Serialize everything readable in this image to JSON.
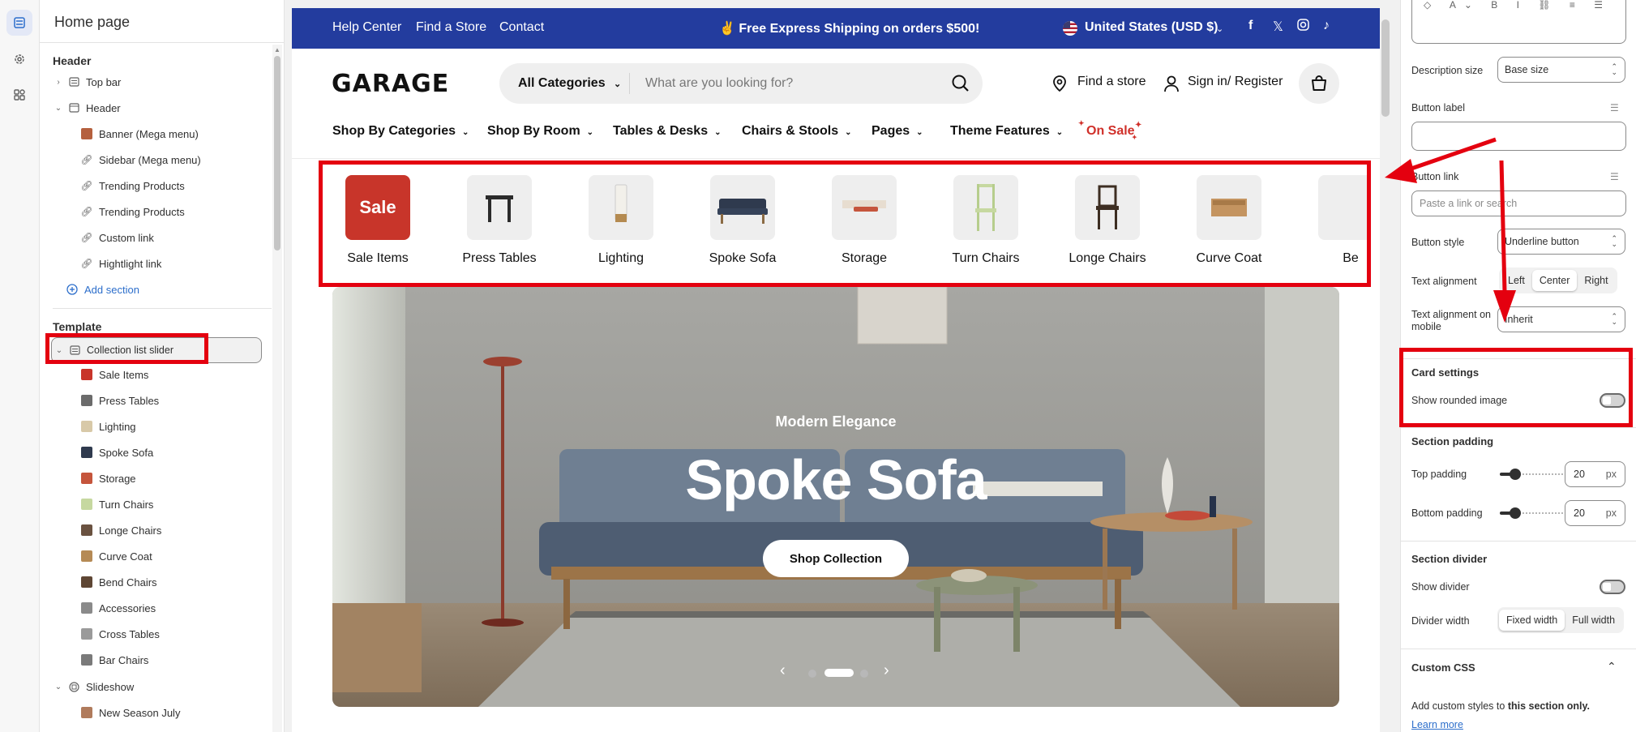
{
  "editor": {
    "page_title": "Home page",
    "header_group": "Header",
    "header_items": [
      {
        "label": "Top bar",
        "icon": "section-icon",
        "expandable": true
      },
      {
        "label": "Header",
        "icon": "section-icon",
        "expandable": true,
        "expanded": true
      }
    ],
    "header_children": [
      {
        "label": "Banner (Mega menu)",
        "icon": "image-block-icon"
      },
      {
        "label": "Sidebar (Mega menu)",
        "icon": "link-icon"
      },
      {
        "label": "Trending Products",
        "icon": "link-icon"
      },
      {
        "label": "Trending Products",
        "icon": "link-icon"
      },
      {
        "label": "Custom link",
        "icon": "link-icon"
      },
      {
        "label": "Hightlight link",
        "icon": "link-icon"
      }
    ],
    "add_section": "Add section",
    "template_group": "Template",
    "selected_section": "Collection list slider",
    "collection_children": [
      "Sale Items",
      "Press Tables",
      "Lighting",
      "Spoke Sofa",
      "Storage",
      "Turn Chairs",
      "Longe Chairs",
      "Curve Coat",
      "Bend Chairs",
      "Accessories",
      "Cross Tables",
      "Bar Chairs"
    ],
    "slideshow_section": "Slideshow",
    "slideshow_children": [
      "New Season July"
    ]
  },
  "store": {
    "announcement": {
      "links": [
        "Help Center",
        "Find a Store",
        "Contact"
      ],
      "promo": "✌️ Free Express Shipping on orders $500!",
      "currency": "United States (USD $)",
      "bg_color": "#233c9e"
    },
    "logo": "GARAGE",
    "search": {
      "category": "All Categories",
      "placeholder": "What are you looking for?"
    },
    "find_store": "Find a store",
    "sign_in": "Sign in/ Register",
    "nav": [
      "Shop By Categories",
      "Shop By Room",
      "Tables & Desks",
      "Chairs & Stools",
      "Pages",
      "Theme Features"
    ],
    "on_sale": "On Sale",
    "sale_color": "#d0302a",
    "collections": [
      {
        "label": "Sale Items",
        "badge": "Sale"
      },
      {
        "label": "Press Tables"
      },
      {
        "label": "Lighting"
      },
      {
        "label": "Spoke Sofa"
      },
      {
        "label": "Storage"
      },
      {
        "label": "Turn Chairs"
      },
      {
        "label": "Longe Chairs"
      },
      {
        "label": "Curve Coat"
      },
      {
        "label": "Be"
      }
    ],
    "hero": {
      "subtitle": "Modern Elegance",
      "title": "Spoke Sofa",
      "button": "Shop Collection"
    }
  },
  "settings": {
    "description_size_label": "Description size",
    "description_size_value": "Base size",
    "button_label_label": "Button label",
    "button_label_value": "",
    "button_link_label": "Button link",
    "button_link_placeholder": "Paste a link or search",
    "button_style_label": "Button style",
    "button_style_value": "Underline button",
    "text_alignment_label": "Text alignment",
    "text_alignment_options": [
      "Left",
      "Center",
      "Right"
    ],
    "text_alignment_selected": "Center",
    "text_alignment_mobile_label": "Text alignment on mobile",
    "text_alignment_mobile_value": "Inherit",
    "card_settings_heading": "Card settings",
    "show_rounded_image_label": "Show rounded image",
    "show_rounded_image_on": false,
    "section_padding_heading": "Section padding",
    "top_padding_label": "Top padding",
    "top_padding_value": "20",
    "bottom_padding_label": "Bottom padding",
    "bottom_padding_value": "20",
    "unit": "px",
    "section_divider_heading": "Section divider",
    "show_divider_label": "Show divider",
    "show_divider_on": false,
    "divider_width_label": "Divider width",
    "divider_width_options": [
      "Fixed width",
      "Full width"
    ],
    "divider_width_selected": "Fixed width",
    "custom_css_heading": "Custom CSS",
    "custom_css_text": "Add custom styles to",
    "custom_css_bold": "this section only.",
    "learn_more": "Learn more"
  },
  "annotation_color": "#e4000f"
}
